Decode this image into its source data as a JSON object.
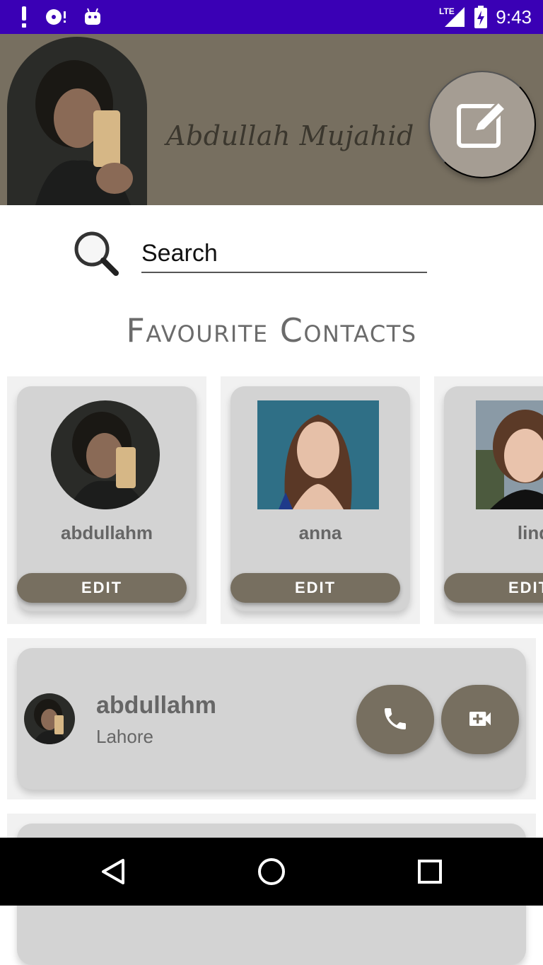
{
  "status_bar": {
    "time": "9:43",
    "network": "LTE",
    "icons": [
      "alert-icon",
      "media-icon",
      "android-icon",
      "signal-icon",
      "battery-charging-icon"
    ]
  },
  "header": {
    "user_name": "Abdullah Mujahid",
    "avatar": "profile-photo-man",
    "edit_icon": "edit-icon"
  },
  "search": {
    "placeholder": "Search",
    "icon": "search-icon"
  },
  "favourites": {
    "title": "Favourite Contacts",
    "edit_label": "EDIT",
    "items": [
      {
        "name": "abdullahm",
        "photo": "profile-photo-man"
      },
      {
        "name": "anna",
        "photo": "profile-photo-woman-long-hair"
      },
      {
        "name": "lind",
        "photo": "profile-photo-woman-short-hair"
      }
    ]
  },
  "contacts": [
    {
      "name": "abdullahm",
      "city": "Lahore",
      "call_icon": "phone-icon",
      "video_icon": "video-call-icon"
    }
  ],
  "nav": {
    "back": "back-icon",
    "home": "home-icon",
    "recents": "recents-icon"
  },
  "colors": {
    "status_bar": "#3a00b5",
    "header": "#776f60",
    "accent": "#776f60",
    "card": "#d3d3d3",
    "fab": "#a59d93"
  }
}
